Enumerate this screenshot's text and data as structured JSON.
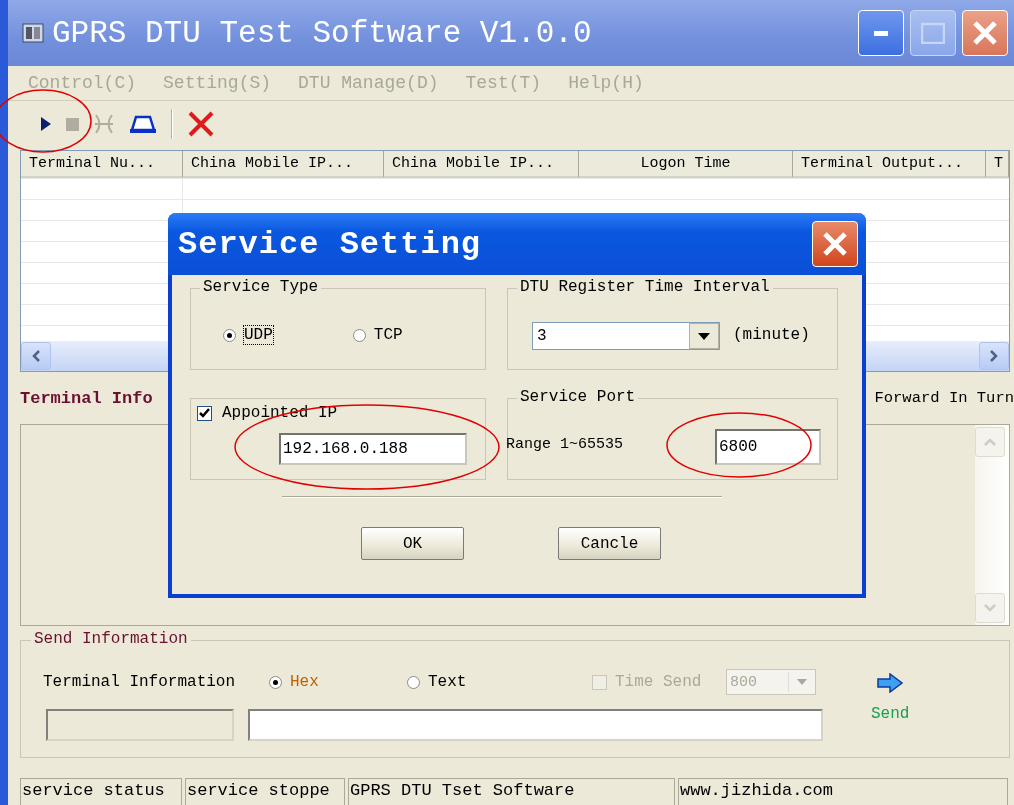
{
  "window": {
    "title": "GPRS DTU Test Software V1.0.0"
  },
  "menu": [
    {
      "label": "Control(C)",
      "disabled": true
    },
    {
      "label": "Setting(S)",
      "disabled": true
    },
    {
      "label": "DTU Manage(D)",
      "disabled": true
    },
    {
      "label": "Test(T)",
      "disabled": true
    },
    {
      "label": "Help(H)",
      "disabled": true
    }
  ],
  "toolbar": [
    {
      "kind": "play",
      "disabled": false
    },
    {
      "kind": "stop",
      "disabled": true
    },
    {
      "kind": "arcs",
      "disabled": true
    },
    {
      "kind": "dome",
      "disabled": false
    },
    {
      "kind": "delete",
      "disabled": false
    }
  ],
  "table": {
    "columns": [
      "Terminal Nu...",
      "China Mobile IP...",
      "China Mobile IP...",
      "Logon Time",
      "Terminal Output...",
      "T"
    ]
  },
  "terminal_info": {
    "label": "Terminal Info",
    "forward_label": "Forward In Turn"
  },
  "send_information": {
    "title": "Send Information",
    "label": "Terminal Information",
    "formats": [
      {
        "label": "Hex",
        "selected": true
      },
      {
        "label": "Text",
        "selected": false
      }
    ],
    "time_send": {
      "label": "Time Send",
      "checked": false,
      "disabled": true,
      "value": "800"
    },
    "send_label": "Send"
  },
  "status_bar": [
    "service status",
    "service stoppe",
    "GPRS DTU Tset Software",
    "www.jizhida.com"
  ],
  "dialog": {
    "title": "Service Setting",
    "service_type": {
      "title": "Service Type",
      "options": [
        {
          "label": "UDP",
          "selected": true
        },
        {
          "label": "TCP",
          "selected": false
        }
      ]
    },
    "register_interval": {
      "title": "DTU Register Time Interval",
      "value": "3",
      "unit": "(minute)"
    },
    "appointed_ip": {
      "label": "Appointed IP",
      "checked": true,
      "value": "192.168.0.188"
    },
    "service_port": {
      "title": "Service Port",
      "range": "Range 1~65535",
      "value": "6800"
    },
    "buttons": [
      "OK",
      "Cancle"
    ]
  }
}
